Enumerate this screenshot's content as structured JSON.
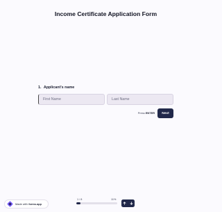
{
  "form": {
    "title": "Income Certificate Application Form",
    "question_number": "1.",
    "question_label": "Applicant's name",
    "first_name_placeholder": "First Name",
    "last_name_placeholder": "Last Name",
    "first_name_value": "",
    "last_name_value": ""
  },
  "actions": {
    "press_prefix": "Press",
    "press_key": "ENTER",
    "next_label": "Next"
  },
  "branding": {
    "made_with_text": "Made with",
    "brand_name": "forms.app"
  },
  "progress": {
    "count_text": "1 / 8",
    "percent_text": "11%",
    "fraction": 0.11
  },
  "colors": {
    "accent": "#21284a",
    "background": "#fbfafe",
    "field_bg": "#ece8f2"
  },
  "icons": {
    "prev": "arrow-up-icon",
    "next": "arrow-down-icon",
    "brand": "forms-app-logo-icon"
  }
}
